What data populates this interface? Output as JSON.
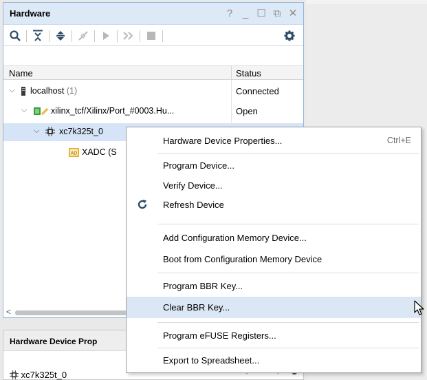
{
  "hardware_panel": {
    "title": "Hardware",
    "title_controls": [
      "?",
      "_",
      "☐",
      "⧉",
      "✕"
    ],
    "columns": {
      "name": "Name",
      "status": "Status"
    },
    "rows": [
      {
        "label": "localhost",
        "count": "(1)",
        "status": "Connected",
        "icon": "server-icon"
      },
      {
        "label": "xilinx_tcf/Xilinx/Port_#0003.Hu...",
        "status": "Open",
        "icon": "cable-icon"
      },
      {
        "label": "xc7k325t_0",
        "status": "",
        "icon": "chip-icon"
      },
      {
        "label": "XADC (S",
        "status": "",
        "icon": "xadc-icon"
      }
    ]
  },
  "props_panel": {
    "title": "Hardware Device Prop",
    "item": "xc7k325t_0"
  },
  "context_menu": {
    "items": [
      {
        "label": "Hardware Device Properties...",
        "shortcut": "Ctrl+E"
      },
      {
        "label": "Program Device..."
      },
      {
        "label": "Verify Device..."
      },
      {
        "label": "Refresh Device",
        "icon": "refresh-icon"
      },
      {
        "label": "Add Configuration Memory Device..."
      },
      {
        "label": "Boot from Configuration Memory Device"
      },
      {
        "label": "Program BBR Key..."
      },
      {
        "label": "Clear BBR Key..."
      },
      {
        "label": "Program eFUSE Registers..."
      },
      {
        "label": "Export to Spreadsheet..."
      }
    ],
    "highlighted": "Clear BBR Key..."
  },
  "colors": {
    "accent": "#1e6fb8",
    "selection": "#d5e4f6",
    "menu_hover": "#dbe7f4",
    "title_bar": "#dde9f6"
  }
}
